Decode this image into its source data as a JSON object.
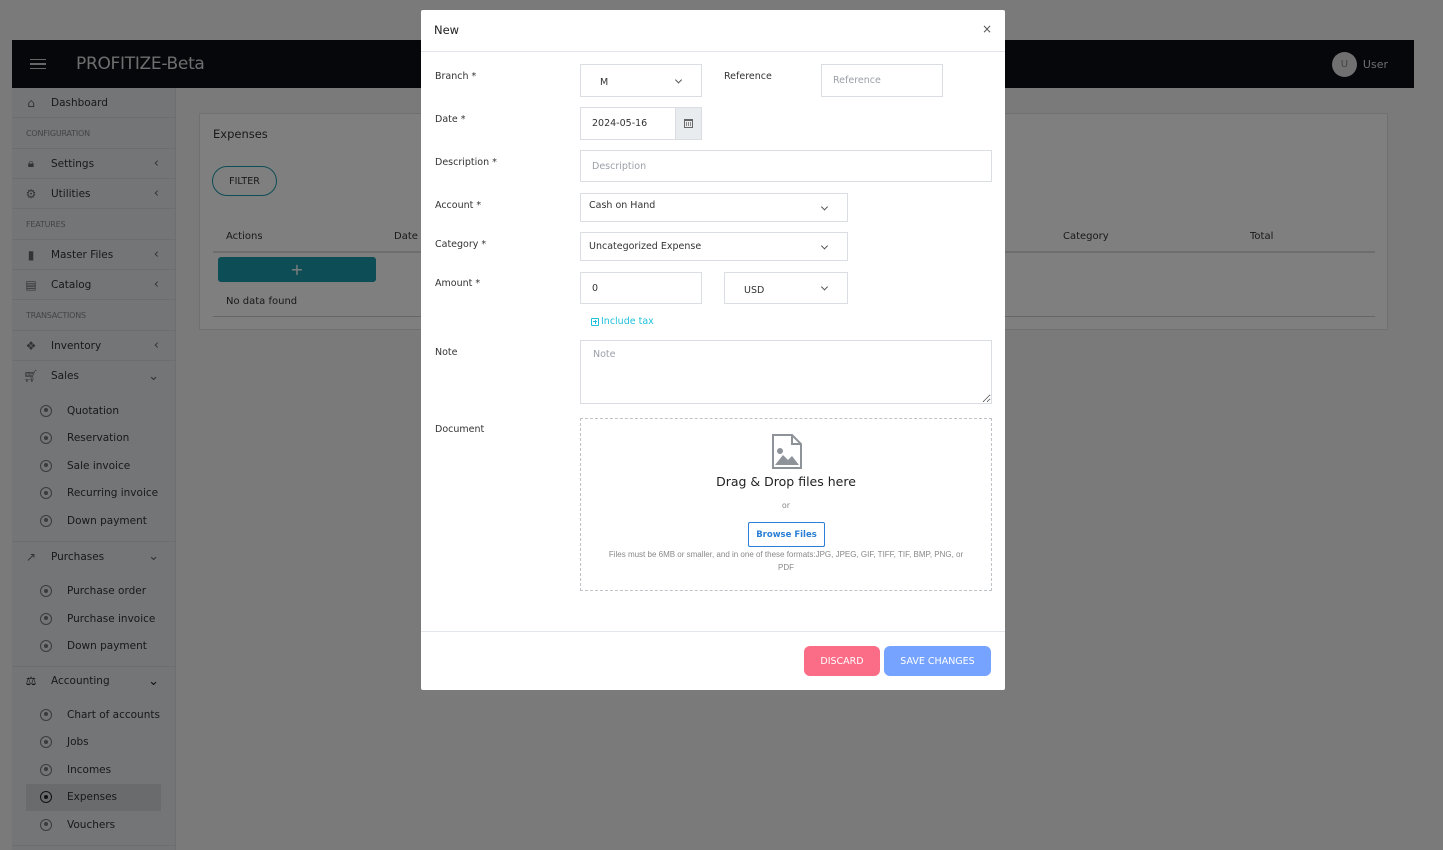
{
  "app": {
    "brand": "PROFITIZE-Beta",
    "user": {
      "initial": "U",
      "name": "User"
    }
  },
  "sidebar": {
    "dashboard": "Dashboard",
    "sections": {
      "configuration": "CONFIGURATION",
      "features": "FEATURES",
      "transactions": "TRANSACTIONS"
    },
    "settings": "Settings",
    "utilities": "Utilities",
    "master_files": "Master Files",
    "catalog": "Catalog",
    "inventory": "Inventory",
    "sales": {
      "label": "Sales",
      "items": [
        "Quotation",
        "Reservation",
        "Sale invoice",
        "Recurring invoice",
        "Down payment"
      ]
    },
    "purchases": {
      "label": "Purchases",
      "items": [
        "Purchase order",
        "Purchase invoice",
        "Down payment"
      ]
    },
    "accounting": {
      "label": "Accounting",
      "items": [
        "Chart of accounts",
        "Jobs",
        "Incomes",
        "Expenses",
        "Vouchers"
      ],
      "active": "Expenses"
    }
  },
  "page": {
    "title": "Expenses",
    "filter_label": "FILTER",
    "columns": [
      "Actions",
      "Date",
      "Category",
      "Total"
    ],
    "add_row_label": "+",
    "empty_text": "No data found"
  },
  "modal": {
    "title": "New",
    "close_label": "×",
    "branch": {
      "label": "Branch *",
      "value": "M"
    },
    "reference": {
      "label": "Reference",
      "placeholder": "Reference",
      "value": ""
    },
    "date": {
      "label": "Date *",
      "value": "2024-05-16"
    },
    "description": {
      "label": "Description *",
      "placeholder": "Description",
      "value": ""
    },
    "account": {
      "label": "Account *",
      "value": "Cash on Hand"
    },
    "category": {
      "label": "Category *",
      "value": "Uncategorized Expense"
    },
    "amount": {
      "label": "Amount *",
      "value": "0",
      "currency": "USD"
    },
    "include_tax": "Include tax",
    "note": {
      "label": "Note",
      "placeholder": "Note",
      "value": ""
    },
    "document": {
      "label": "Document",
      "drop_title": "Drag & Drop files here",
      "or": "or",
      "browse_label": "Browse Files",
      "hint": "Files must be 6MB or smaller, and in one of these formats:JPG, JPEG, GIF, TIFF, TIF, BMP, PNG, or PDF"
    },
    "discard_label": "DISCARD",
    "save_label": "SAVE CHANGES"
  },
  "colors": {
    "accent": "#1b9aaa",
    "discard": "#fb6c86",
    "save": "#76a3ff",
    "link": "#1ec0da",
    "browse": "#2a7fd6"
  }
}
